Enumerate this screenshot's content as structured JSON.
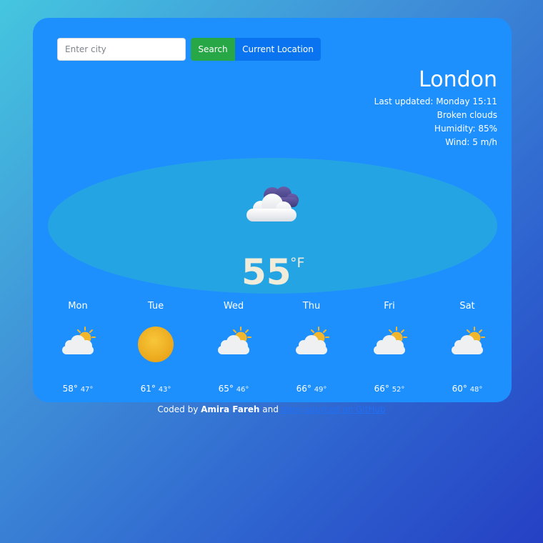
{
  "search": {
    "placeholder": "Enter city",
    "search_label": "Search",
    "location_label": "Current Location"
  },
  "current": {
    "city": "London",
    "last_updated": "Last updated: Monday 15:11",
    "description": "Broken clouds",
    "humidity": "Humidity: 85%",
    "wind": "Wind: 5 m/h",
    "temperature": "55",
    "unit": "°F",
    "icon": "broken-clouds-icon"
  },
  "forecast": [
    {
      "day": "Mon",
      "max": "58°",
      "min": "47°",
      "icon": "partly-cloudy-icon"
    },
    {
      "day": "Tue",
      "max": "61°",
      "min": "43°",
      "icon": "sun-icon"
    },
    {
      "day": "Wed",
      "max": "65°",
      "min": "46°",
      "icon": "partly-cloudy-icon"
    },
    {
      "day": "Thu",
      "max": "66°",
      "min": "49°",
      "icon": "partly-cloudy-icon"
    },
    {
      "day": "Fri",
      "max": "66°",
      "min": "52°",
      "icon": "partly-cloudy-icon"
    },
    {
      "day": "Sat",
      "max": "60°",
      "min": "48°",
      "icon": "partly-cloudy-icon"
    }
  ],
  "footer": {
    "prefix": "Coded by",
    "author": "Amira Fareh",
    "connector": "and",
    "link_text": "open-sourced on GitHub"
  },
  "colors": {
    "card": "#1e90fe",
    "search_button": "#27a745",
    "location_button": "#0a73ef",
    "temperature_text": "#f1ecd9",
    "link": "#1f6ff5"
  }
}
